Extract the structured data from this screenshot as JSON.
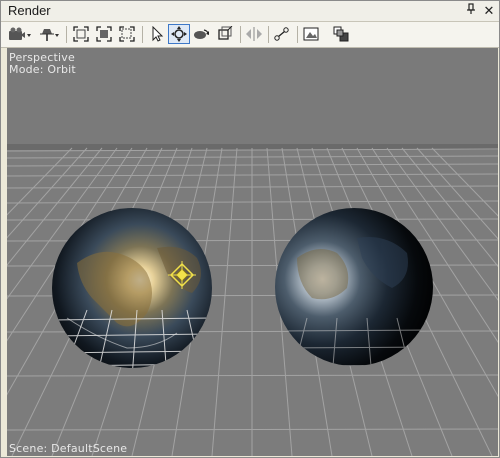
{
  "window": {
    "title": "Render",
    "pin_glyph": "❙",
    "close_glyph": "✕"
  },
  "toolbar": {
    "buttons": [
      {
        "name": "camera-dropdown-icon"
      },
      {
        "name": "light-dropdown-icon"
      },
      {
        "name": "zoom-extents-icon"
      },
      {
        "name": "zoom-selected-icon"
      },
      {
        "name": "zoom-region-icon"
      },
      {
        "name": "select-tool-icon"
      },
      {
        "name": "move-tool-icon",
        "active": true
      },
      {
        "name": "rotate-tool-icon"
      },
      {
        "name": "scale-tool-icon"
      },
      {
        "name": "mirror-tool-icon"
      },
      {
        "name": "bone-tool-icon"
      },
      {
        "name": "screenshot-icon"
      },
      {
        "name": "layout-icon"
      }
    ]
  },
  "viewport": {
    "projection": "Perspective",
    "mode": "Mode: Orbit",
    "scene": "Scene: DefaultScene",
    "background_color": "#7a7a7a",
    "grid_color": "#9a9a9a",
    "gizmo_color": "#f2e24a"
  }
}
